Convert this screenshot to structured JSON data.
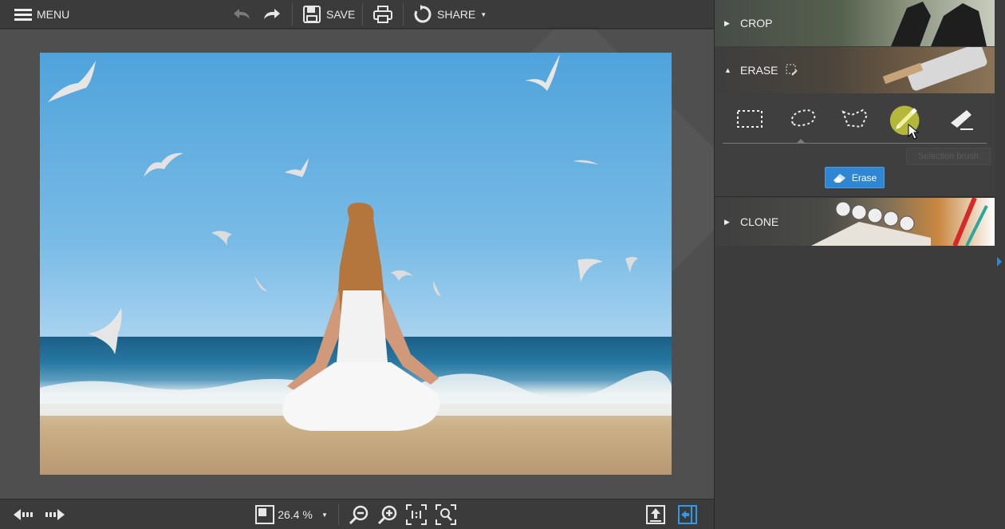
{
  "toolbar": {
    "menu_label": "MENU",
    "save_label": "SAVE",
    "share_label": "SHARE",
    "icons": [
      "menu-icon",
      "undo-icon",
      "redo-icon",
      "save-icon",
      "print-icon",
      "share-icon"
    ]
  },
  "panel": {
    "sections": [
      {
        "label": "CROP",
        "expanded": false
      },
      {
        "label": "ERASE",
        "expanded": true
      },
      {
        "label": "CLONE",
        "expanded": false
      }
    ],
    "erase_tools": [
      "rectangle-selection",
      "lasso-selection",
      "polygon-selection",
      "selection-brush",
      "erase-brush"
    ],
    "active_tool": "selection-brush",
    "tooltip": "Selection brush",
    "erase_button": "Erase"
  },
  "bottombar": {
    "zoom_value": "26.4 %",
    "icons": [
      "prev-icon",
      "next-icon",
      "fit-icon",
      "zoom-dropdown-icon",
      "zoom-out-icon",
      "zoom-in-icon",
      "actual-size-icon",
      "zoom-fit-icon",
      "export-icon",
      "panel-toggle-icon"
    ]
  },
  "colors": {
    "accent": "#2f86d3",
    "panel_bg": "#3c3c3c",
    "canvas_bg": "#4f4f4f",
    "active_tool_highlight": "#e2e646"
  }
}
